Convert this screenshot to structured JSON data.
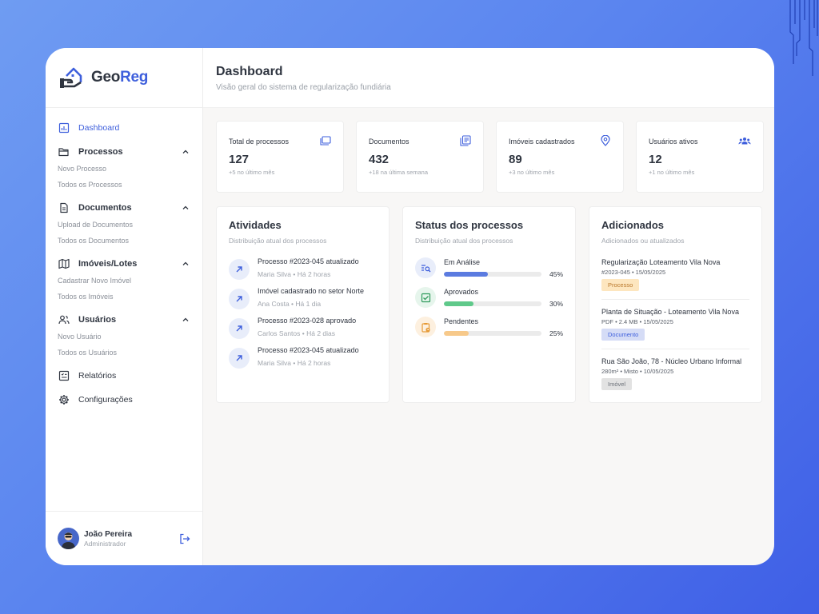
{
  "brand": {
    "name_part1": "Geo",
    "name_part2": "Reg"
  },
  "header": {
    "title": "Dashboard",
    "subtitle": "Visão geral do sistema de regularização fundiária"
  },
  "sidebar": {
    "dashboard": "Dashboard",
    "groups": [
      {
        "label": "Processos",
        "icon": "folder-icon",
        "items": [
          "Novo Processo",
          "Todos os Processos"
        ]
      },
      {
        "label": "Documentos",
        "icon": "document-icon",
        "items": [
          "Upload de Documentos",
          "Todos os Documentos"
        ]
      },
      {
        "label": "Imóveis/Lotes",
        "icon": "map-icon",
        "items": [
          "Cadastrar Novo Imóvel",
          "Todos os Imóveis"
        ]
      },
      {
        "label": "Usuários",
        "icon": "users-icon",
        "items": [
          "Novo Usuário",
          "Todos os Usuários"
        ]
      }
    ],
    "reports": "Relatórios",
    "settings": "Configurações"
  },
  "user": {
    "name": "João Pereira",
    "role": "Administrador"
  },
  "stats": [
    {
      "label": "Total de processos",
      "value": "127",
      "note": "+5 no último mês",
      "icon": "folders-icon"
    },
    {
      "label": "Documentos",
      "value": "432",
      "note": "+18 na última semana",
      "icon": "documents-icon"
    },
    {
      "label": "Imóveis cadastrados",
      "value": "89",
      "note": "+3 no último mês",
      "icon": "map-pin-icon"
    },
    {
      "label": "Usuários ativos",
      "value": "12",
      "note": "+1 no último mês",
      "icon": "users-group-icon"
    }
  ],
  "activities": {
    "title": "Atividades",
    "subtitle": "Distribuição atual dos processos",
    "items": [
      {
        "text": "Processo #2023-045 atualizado",
        "meta": "Maria Silva • Há 2 horas"
      },
      {
        "text": "Imóvel cadastrado no setor Norte",
        "meta": "Ana Costa • Há 1 dia"
      },
      {
        "text": "Processo #2023-028 aprovado",
        "meta": "Carlos Santos • Há 2 dias"
      },
      {
        "text": "Processo #2023-045 atualizado",
        "meta": "Maria Silva • Há 2 horas"
      }
    ]
  },
  "status": {
    "title": "Status dos processos",
    "subtitle": "Distribuição atual dos processos",
    "items": [
      {
        "label": "Em Análise",
        "pct": "45%",
        "value": 45,
        "color": "#5b7be0",
        "bg": "#e8edfa",
        "icon": "search-list-icon",
        "iconColor": "#3e5fdc"
      },
      {
        "label": "Aprovados",
        "pct": "30%",
        "value": 30,
        "color": "#5fc98a",
        "bg": "#e6f5ec",
        "icon": "check-list-icon",
        "iconColor": "#2f9a5b"
      },
      {
        "label": "Pendentes",
        "pct": "25%",
        "value": 25,
        "color": "#f7c98a",
        "bg": "#fdf0df",
        "icon": "clipboard-clock-icon",
        "iconColor": "#e69a36"
      }
    ]
  },
  "added": {
    "title": "Adicionados",
    "subtitle": "Adicionados ou atualizados",
    "items": [
      {
        "title": "Regularização Loteamento Vila Nova",
        "meta": "#2023-045 • 15/05/2025",
        "badge": "Processo",
        "badgeBg": "#fde6bf",
        "badgeColor": "#b9782c"
      },
      {
        "title": "Planta de Situação - Loteamento Vila Nova",
        "meta": "PDF • 2.4 MB • 15/05/2025",
        "badge": "Documento",
        "badgeBg": "#d5dcf6",
        "badgeColor": "#3e5fdc"
      },
      {
        "title": "Rua São João, 78 - Núcleo Urbano Informal",
        "meta": "280m² • Misto • 10/05/2025",
        "badge": "Imóvel",
        "badgeBg": "#e2e2e2",
        "badgeColor": "#6b7078"
      }
    ]
  }
}
